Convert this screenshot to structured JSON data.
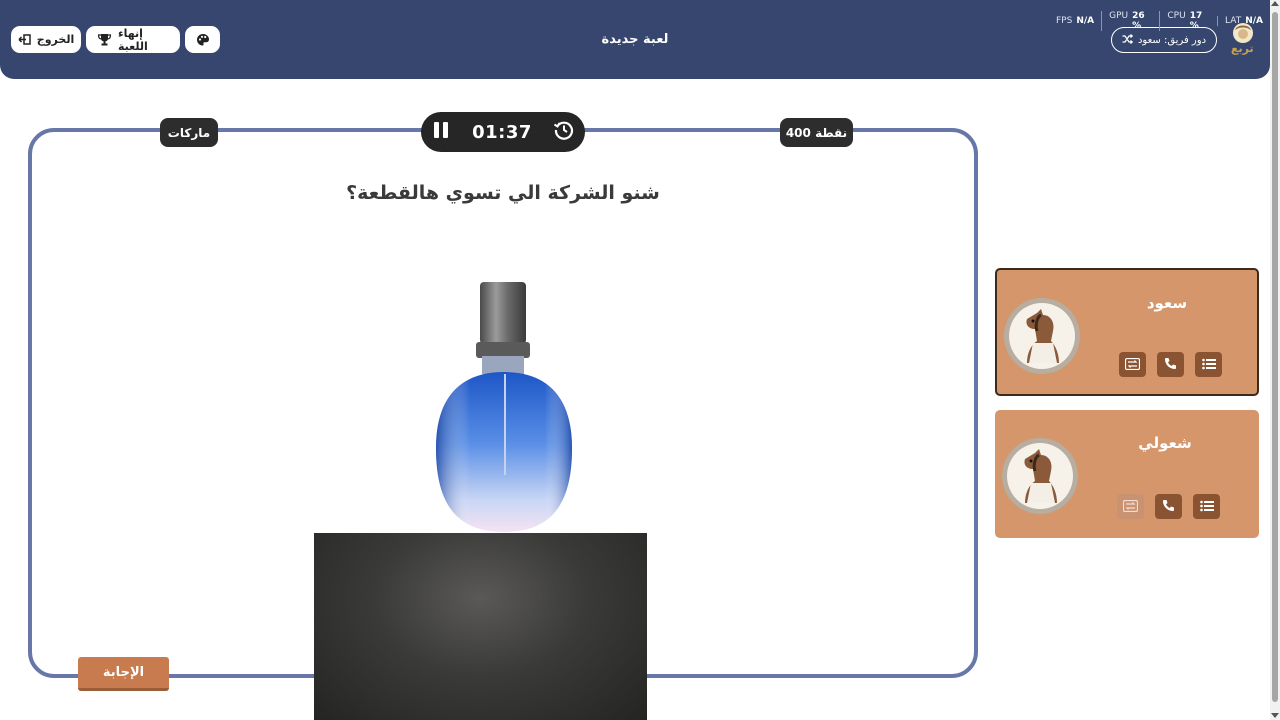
{
  "header": {
    "title": "لعبة جديدة",
    "exit_label": "الخروج",
    "end_game_label": "إنهاء اللعبة",
    "turn_label": "دور فريق: سعود",
    "logo_text": "تربع",
    "stats": [
      {
        "name": "LAT",
        "value": "N/A"
      },
      {
        "name": "CPU",
        "value": "17 %"
      },
      {
        "name": "GPU",
        "value": "26 %"
      },
      {
        "name": "FPS",
        "value": "N/A"
      }
    ]
  },
  "question": {
    "category": "ماركات",
    "points": "400 نقطة",
    "timer": "01:37",
    "text": "شنو الشركة الي تسوي هالقطعة؟",
    "answer_label": "الإجابة"
  },
  "teams": [
    {
      "name": "سعود",
      "active": true
    },
    {
      "name": "شعولي",
      "active": false
    }
  ],
  "colors": {
    "header_bg": "#37466e",
    "frame_border": "#6778a8",
    "team_card": "#d4966a",
    "help_button": "#8a5432",
    "answer_button": "#c77b4e"
  }
}
